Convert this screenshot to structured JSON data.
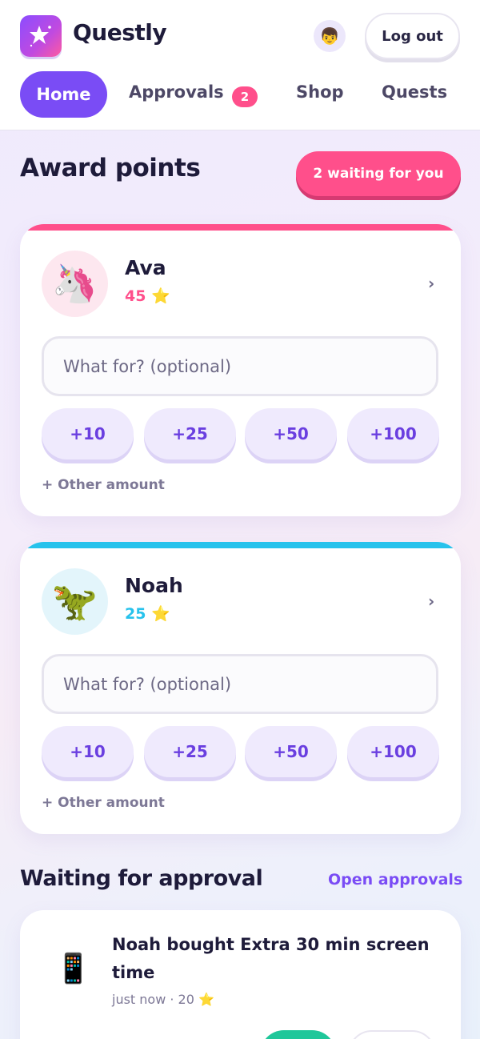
{
  "app": {
    "name": "Questly",
    "user_avatar": "👦",
    "logout_label": "Log out"
  },
  "nav": {
    "home": "Home",
    "approvals": "Approvals",
    "approvals_badge": "2",
    "shop": "Shop",
    "quests": "Quests"
  },
  "award": {
    "title": "Award points",
    "waiting_label": "2 waiting for you"
  },
  "kids": [
    {
      "name": "Ava",
      "avatar": "🦄",
      "points": "45 ⭐",
      "accent": "#ff4f8b",
      "avatar_bg": "#fde7ef",
      "note_placeholder": "What for? (optional)",
      "amounts": [
        "+10",
        "+25",
        "+50",
        "+100"
      ],
      "other_label": "+ Other amount"
    },
    {
      "name": "Noah",
      "avatar": "🦖",
      "points": "25 ⭐",
      "accent": "#27c2ec",
      "avatar_bg": "#e3f5fb",
      "note_placeholder": "What for? (optional)",
      "amounts": [
        "+10",
        "+25",
        "+50",
        "+100"
      ],
      "other_label": "+ Other amount"
    }
  ],
  "approvals": {
    "title": "Waiting for approval",
    "open_link": "Open approvals",
    "items": [
      {
        "icon": "📱",
        "text": "Noah bought Extra 30 min screen time",
        "meta": "just now · 20 ⭐"
      }
    ]
  }
}
